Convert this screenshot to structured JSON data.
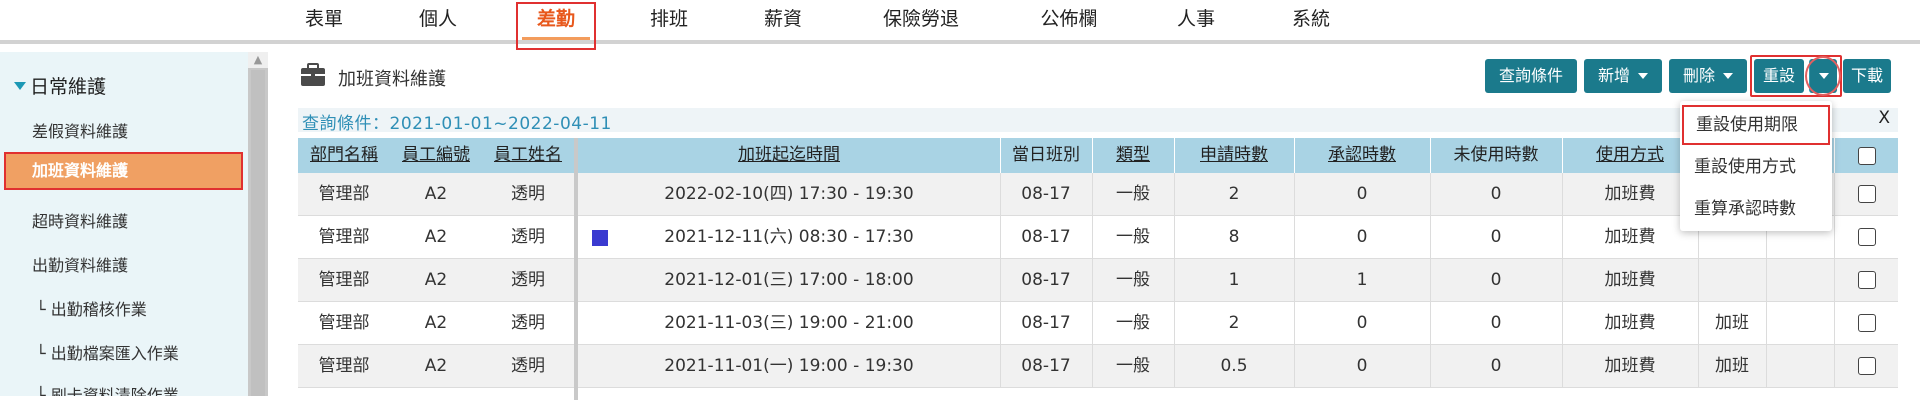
{
  "topnav": {
    "items": [
      {
        "label": "表單"
      },
      {
        "label": "個人"
      },
      {
        "label": "差勤"
      },
      {
        "label": "排班"
      },
      {
        "label": "薪資"
      },
      {
        "label": "保險勞退"
      },
      {
        "label": "公佈欄"
      },
      {
        "label": "人事"
      },
      {
        "label": "系統"
      }
    ],
    "active_index": 2
  },
  "sidebar": {
    "group_label": "日常維護",
    "items": [
      {
        "label": "差假資料維護"
      },
      {
        "label": "加班資料維護"
      },
      {
        "label": "超時資料維護"
      },
      {
        "label": "出勤資料維護"
      },
      {
        "label": "└ 出勤稽核作業"
      },
      {
        "label": "└ 出勤檔案匯入作業"
      },
      {
        "label": "└ 刷卡資料清除作業"
      }
    ],
    "active_index": 1
  },
  "header": {
    "title": "加班資料維護",
    "buttons": {
      "query": "查詢條件",
      "add": "新增",
      "delete": "刪除",
      "reset": "重設",
      "download": "下載"
    }
  },
  "query_bar": {
    "text": "查詢條件：2021-01-01~2022-04-11",
    "close": "X"
  },
  "table": {
    "headers": {
      "dept": "部門名稱",
      "emp_no": "員工編號",
      "emp_name": "員工姓名",
      "period": "加班起迄時間",
      "shift": "當日班別",
      "type": "類型",
      "applied": "申請時數",
      "approved": "承認時數",
      "unused": "未使用時數",
      "usage": "使用方式"
    },
    "rows": [
      {
        "dept": "管理部",
        "emp_no": "A2",
        "emp_name": "透明",
        "period": "2022-02-10(四) 17:30 - 19:30",
        "shift": "08-17",
        "type": "一般",
        "applied": "2",
        "approved": "0",
        "unused": "0",
        "usage": "加班費",
        "extra": "",
        "flag": false
      },
      {
        "dept": "管理部",
        "emp_no": "A2",
        "emp_name": "透明",
        "period": "2021-12-11(六) 08:30 - 17:30",
        "shift": "08-17",
        "type": "一般",
        "applied": "8",
        "approved": "0",
        "unused": "0",
        "usage": "加班費",
        "extra": "",
        "flag": true
      },
      {
        "dept": "管理部",
        "emp_no": "A2",
        "emp_name": "透明",
        "period": "2021-12-01(三) 17:00 - 18:00",
        "shift": "08-17",
        "type": "一般",
        "applied": "1",
        "approved": "1",
        "unused": "0",
        "usage": "加班費",
        "extra": "",
        "flag": false
      },
      {
        "dept": "管理部",
        "emp_no": "A2",
        "emp_name": "透明",
        "period": "2021-11-03(三) 19:00 - 21:00",
        "shift": "08-17",
        "type": "一般",
        "applied": "2",
        "approved": "0",
        "unused": "0",
        "usage": "加班費",
        "extra": "加班",
        "flag": false
      },
      {
        "dept": "管理部",
        "emp_no": "A2",
        "emp_name": "透明",
        "period": "2021-11-01(一) 19:00 - 19:30",
        "shift": "08-17",
        "type": "一般",
        "applied": "0.5",
        "approved": "0",
        "unused": "0",
        "usage": "加班費",
        "extra": "加班",
        "flag": false
      }
    ]
  },
  "reset_menu": {
    "items": [
      {
        "label": "重設使用期限"
      },
      {
        "label": "重設使用方式"
      },
      {
        "label": "重算承認時數"
      }
    ]
  },
  "colors": {
    "accent_orange": "#e8581c",
    "button_teal": "#1b7a8c",
    "header_blue": "#a9d3e4",
    "highlight_red": "#e03030"
  }
}
